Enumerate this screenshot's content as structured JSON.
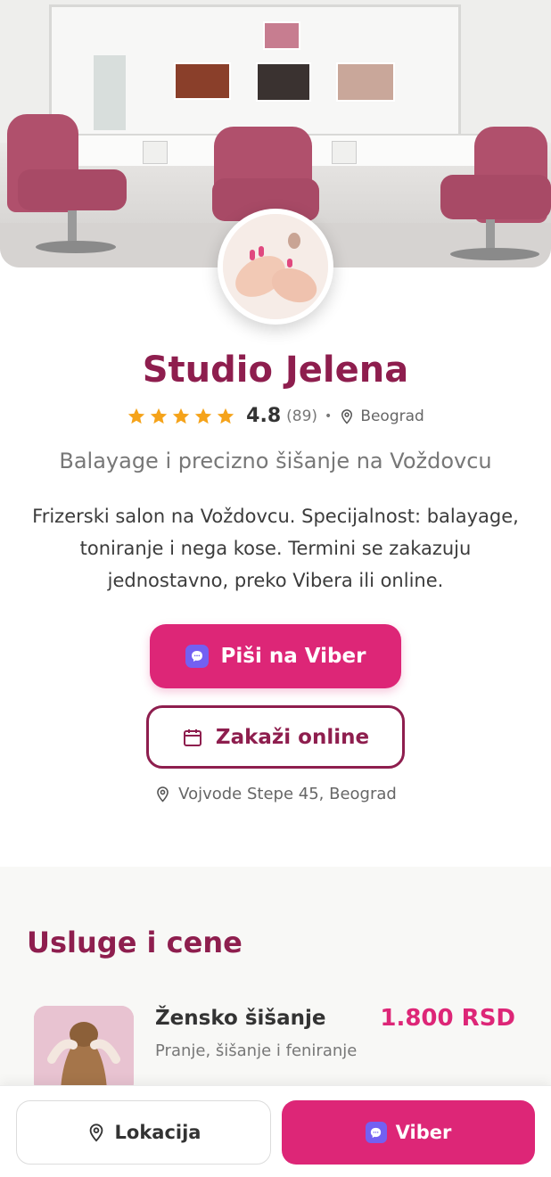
{
  "salon": {
    "name": "Studio Jelena",
    "rating": "4.8",
    "rating_value": 4.8,
    "stars": 5,
    "review_count": "(89)",
    "city": "Beograd",
    "tagline": "Balayage i precizno šišanje na Voždovcu",
    "description": "Frizerski salon na Voždovcu. Specijalnost: balayage, toniranje i nega kose. Termini se zakazuju jednostavno, preko Vibera ili online.",
    "address": "Vojvode Stepe 45, Beograd"
  },
  "actions": {
    "viber_label": "Piši na Viber",
    "online_label": "Zakaži online"
  },
  "services": {
    "title": "Usluge i cene",
    "items": [
      {
        "name": "Žensko šišanje",
        "price": "1.800 RSD",
        "description": "Pranje, šišanje i feniranje"
      }
    ]
  },
  "bottom_bar": {
    "location_label": "Lokacija",
    "viber_label": "Viber"
  },
  "colors": {
    "primary": "#dd2677",
    "brand_dark": "#8e1e4e",
    "viber": "#7360f2",
    "star": "#f5a31a"
  },
  "icons": {
    "rating": "star-icon",
    "city": "map-pin-icon",
    "viber": "viber-icon",
    "online": "calendar-icon",
    "address": "map-pin-icon",
    "location": "map-pin-icon"
  }
}
